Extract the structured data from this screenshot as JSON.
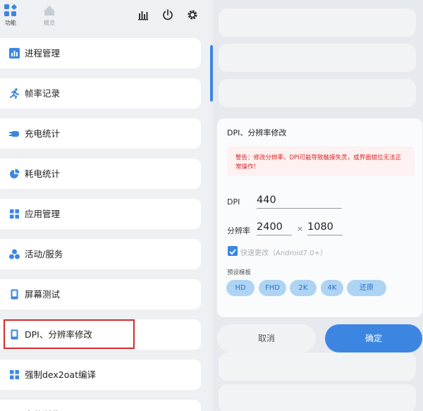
{
  "tabs": [
    {
      "label": "功能",
      "icon": "grid-apps-icon",
      "active": true
    },
    {
      "label": "概览",
      "icon": "home-icon",
      "active": false
    }
  ],
  "header_icons": [
    "bar-chart-icon",
    "power-icon",
    "gear-icon"
  ],
  "menu": [
    {
      "label": "进程管理",
      "icon": "bar-chart-icon"
    },
    {
      "label": "帧率记录",
      "icon": "running-man-icon"
    },
    {
      "label": "充电统计",
      "icon": "plug-icon"
    },
    {
      "label": "耗电统计",
      "icon": "pie-chart-icon"
    },
    {
      "label": "应用管理",
      "icon": "grid-icon"
    },
    {
      "label": "活动/服务",
      "icon": "cluster-icon"
    },
    {
      "label": "屏幕测试",
      "icon": "phone-icon"
    },
    {
      "label": "DPI、分辨率修改",
      "icon": "phone-icon"
    },
    {
      "label": "强制dex2oat编译",
      "icon": "grid-icon"
    },
    {
      "label": "文件浏览",
      "icon": "folder-icon"
    }
  ],
  "dialog": {
    "title": "DPI、分辨率修改",
    "warning": "警告：修改分辨率、DPI可能导致触摸失灵，或界面错位无法正常操作！",
    "dpi_label": "DPI",
    "dpi_value": "440",
    "resolution_label": "分辨率",
    "width_value": "2400",
    "height_value": "1080",
    "times": "×",
    "quick_change_label": "快速更改（Android7.0+）",
    "quick_change_checked": true,
    "presets_label": "预设模板",
    "presets": [
      "HD",
      "FHD",
      "2K",
      "4K",
      "还原"
    ],
    "cancel_label": "取消",
    "confirm_label": "确定"
  },
  "colors": {
    "accent": "#3c86e2",
    "warning": "#d42a2a",
    "chip": "#aed3f3"
  }
}
